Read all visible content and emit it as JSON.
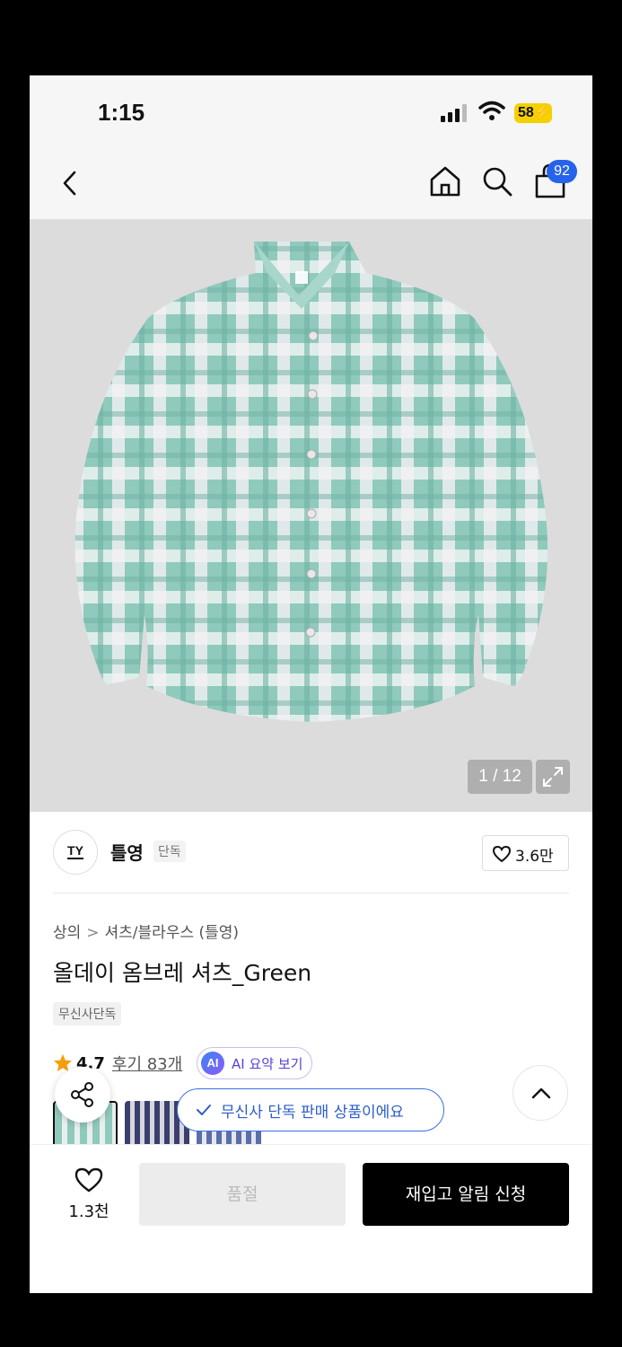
{
  "status_bar": {
    "time": "1:15",
    "battery": "58"
  },
  "nav": {
    "cart_count": "92"
  },
  "gallery": {
    "counter": "1 / 12"
  },
  "brand": {
    "logo_text": "TY",
    "name": "틀영",
    "tag": "단독",
    "likes": "3.6만"
  },
  "product": {
    "breadcrumb": [
      "상의",
      "셔츠/블라우스 (틀영)"
    ],
    "breadcrumb_sep": ">",
    "title": "올데이 옴브레 셔츠_Green",
    "exclusive_badge": "무신사단독",
    "rating": "4.7",
    "reviews": "후기 83개",
    "ai_label": "AI",
    "ai_summary": "AI 요약 보기"
  },
  "toast": "무신사 단독 판매 상품이에요",
  "bottom_bar": {
    "like_count": "1.3천",
    "soldout_label": "품절",
    "restock_label": "재입고 알림 신청"
  },
  "colors": {
    "accent_blue": "#2563eb",
    "shirt_green": "#7fc4b6",
    "star": "#f59e0b"
  },
  "icons": [
    "back-icon",
    "home-icon",
    "search-icon",
    "bag-icon",
    "expand-icon",
    "heart-icon",
    "star-icon",
    "share-icon",
    "check-icon",
    "chevron-up-icon"
  ]
}
